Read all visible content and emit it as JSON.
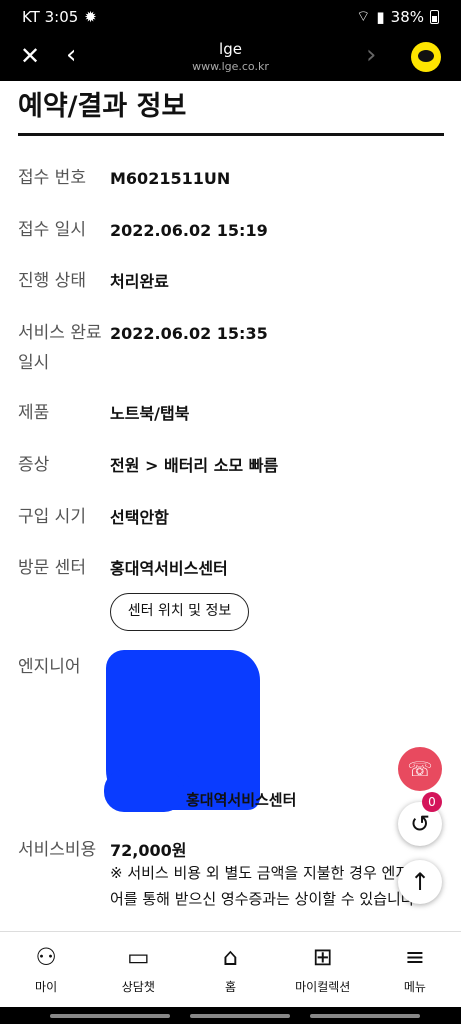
{
  "status": {
    "carrier_time": "KT 3:05",
    "battery": "38%"
  },
  "browser": {
    "title": "lge",
    "url": "www.lge.co.kr"
  },
  "page": {
    "heading": "예약/결과 정보"
  },
  "fields": [
    {
      "label": "접수 번호",
      "value": "M6021511UN"
    },
    {
      "label": "접수 일시",
      "value": "2022.06.02 15:19"
    },
    {
      "label": "진행 상태",
      "value": "처리완료"
    },
    {
      "label": "서비스 완료",
      "label2": "일시",
      "value": "2022.06.02 15:35"
    },
    {
      "label": "제품",
      "value": "노트북/탭북"
    },
    {
      "label": "증상",
      "value": "전원 > 배터리 소모 빠름"
    },
    {
      "label": "구입 시기",
      "value": "선택안함"
    },
    {
      "label": "방문 센터",
      "value": "홍대역서비스센터"
    },
    {
      "label": "엔지니어",
      "value": "홍대역서비스센터"
    },
    {
      "label": "서비스비용",
      "value": "72,000원"
    }
  ],
  "center_button": "센터 위치 및 정보",
  "cost_note": "※ 서비스 비용 외 별도 금액을 지불한 경우 엔지니어를 통해 받으신 영수증과는 상이할 수 있습니다",
  "floating": {
    "recent_count": "0"
  },
  "nav": [
    {
      "label": "마이",
      "icon": "person-icon"
    },
    {
      "label": "상담챗",
      "icon": "chat-icon"
    },
    {
      "label": "홈",
      "icon": "home-icon"
    },
    {
      "label": "마이컬렉션",
      "icon": "collection-icon"
    },
    {
      "label": "메뉴",
      "icon": "menu-icon"
    }
  ]
}
